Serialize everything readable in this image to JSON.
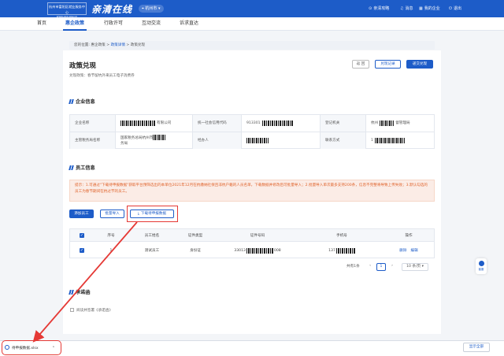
{
  "header": {
    "logo_text": "杭州市富阳区就业服务中心",
    "logo_sub": "www.xxx.gov.cn",
    "slogan": "亲清在线",
    "city": "杭州市",
    "links": [
      "亲清攻略",
      "消息",
      "我的企业",
      "退出"
    ]
  },
  "nav": {
    "items": [
      "首页",
      "惠企政策",
      "行政许可",
      "互动交流",
      "诉求直达"
    ],
    "active_index": 1
  },
  "breadcrumb": {
    "prefix": "您的位置: ",
    "items": [
      "惠企政策",
      "政策详情",
      "政策兑现"
    ]
  },
  "page": {
    "title": "政策兑现",
    "subtitle": "兑现政策：春节留杭外来员工电子消费券",
    "buttons": {
      "back": "返 回",
      "record": "兑现记录",
      "submit": "递交兑现"
    }
  },
  "company": {
    "section_title": "企业信息",
    "rows": [
      [
        {
          "label": "企业名称",
          "value": "有限公司"
        },
        {
          "label": "统一社会信用代码",
          "value": "913301"
        },
        {
          "label": "登记机关",
          "value": "杭州",
          "value2": "督管理局"
        }
      ],
      [
        {
          "label": "主管税务局名称",
          "value": "国家税务总局杭州市",
          "value2": "务局"
        },
        {
          "label": "经办人",
          "value": ""
        },
        {
          "label": "联系方式",
          "value": "1"
        }
      ]
    ]
  },
  "employees": {
    "section_title": "员工信息",
    "notice": "提示：1.可通过\"下载待申报数据\"获取平台预筛选出的本单位2021年12月在杭缴纳社保且非杭户籍的人员名单，下载数据并修改后可批量导入；2.批量导入单次最多支持200条，信息不完整将导致上传失败；3.默认勾选的员工为春节期间在杭过节的员工。",
    "buttons": {
      "add": "添加员工",
      "import": "批量导入",
      "download": "下载待申报数据"
    },
    "columns": [
      "",
      "序号",
      "员工姓名",
      "证件类型",
      "证件号码",
      "手机号",
      "操作"
    ],
    "rows": [
      {
        "index": "1",
        "name": "测试员工",
        "id_type": "身份证",
        "id_prefix": "33013",
        "id_suffix": "008",
        "phone_prefix": "137",
        "ops": [
          "删除",
          "编辑"
        ]
      }
    ],
    "checkbox_mark": "✓",
    "pagination": {
      "total": "共有1条",
      "prev": "‹",
      "page": "1",
      "next": "›",
      "per_page": "10 条/页"
    }
  },
  "commitment": {
    "section_title": "承诺函",
    "consent": "阅读并签署《承诺函》"
  },
  "side_tool": {
    "label": "客服"
  },
  "download_bar": {
    "filename": "待申报数据.xlsx",
    "chevron": "⌃",
    "show_all": "显示全部"
  },
  "colors": {
    "primary": "#1d5cc8",
    "highlight": "#e53935",
    "notice_text": "#e0632b"
  },
  "icons": [
    "guide-icon",
    "bell-icon",
    "building-icon",
    "logout-icon",
    "download-icon",
    "file-icon",
    "chat-icon",
    "location-pin-icon"
  ]
}
